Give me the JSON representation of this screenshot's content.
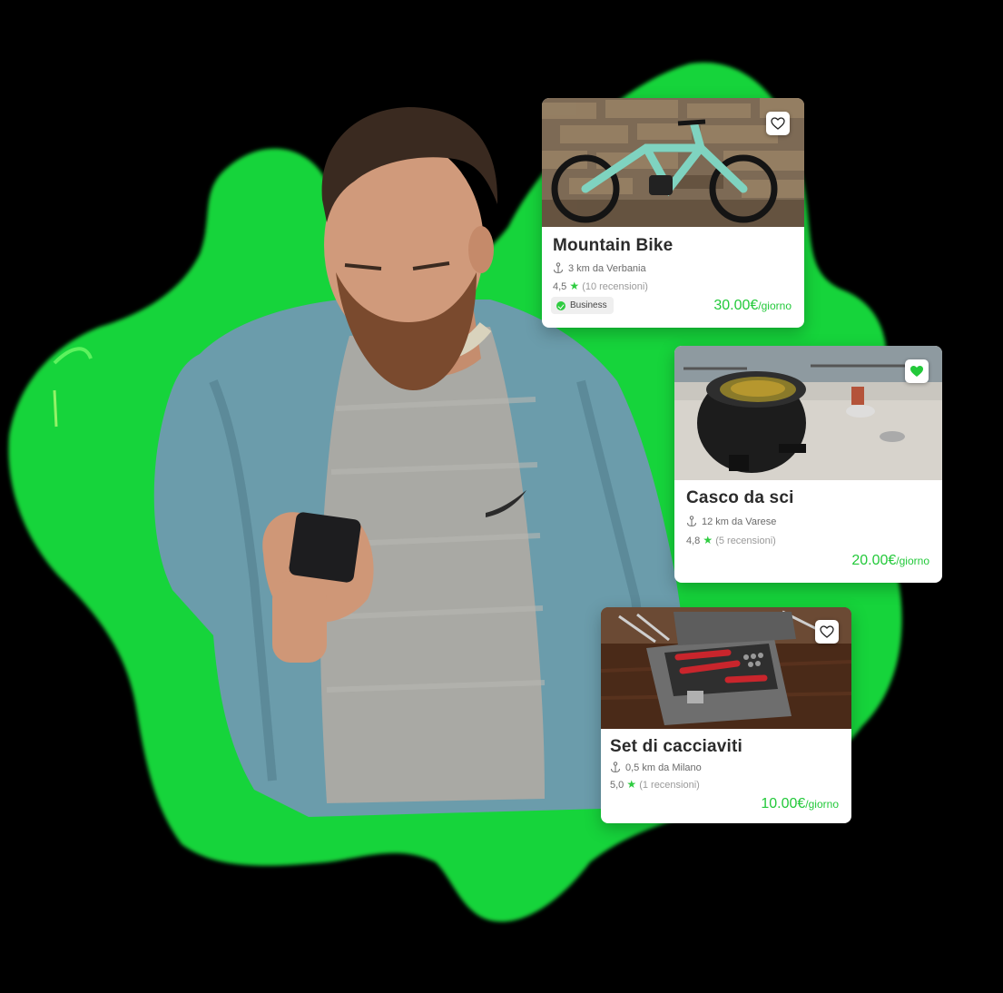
{
  "colors": {
    "brand_green": "#23c93a",
    "blob_green": "#18d43a",
    "background": "#000000"
  },
  "cards": [
    {
      "title": "Mountain Bike",
      "location": "3 km da Verbania",
      "rating": "4,5",
      "reviews": "(10 recensioni)",
      "badge": "Business",
      "price": "30.00€",
      "price_unit": "/giorno",
      "favorite": false,
      "icons": {
        "location": "anchor-pin-icon",
        "favorite": "heart-outline-icon",
        "badge": "verified-check-icon"
      }
    },
    {
      "title": "Casco da sci",
      "location": "12 km da Varese",
      "rating": "4,8",
      "reviews": "(5 recensioni)",
      "price": "20.00€",
      "price_unit": "/giorno",
      "favorite": true,
      "icons": {
        "location": "anchor-pin-icon",
        "favorite": "heart-filled-icon"
      }
    },
    {
      "title": "Set di cacciaviti",
      "location": "0,5 km da Milano",
      "rating": "5,0",
      "reviews": "(1 recensioni)",
      "price": "10.00€",
      "price_unit": "/giorno",
      "favorite": false,
      "icons": {
        "location": "anchor-pin-icon",
        "favorite": "heart-outline-icon"
      }
    }
  ]
}
